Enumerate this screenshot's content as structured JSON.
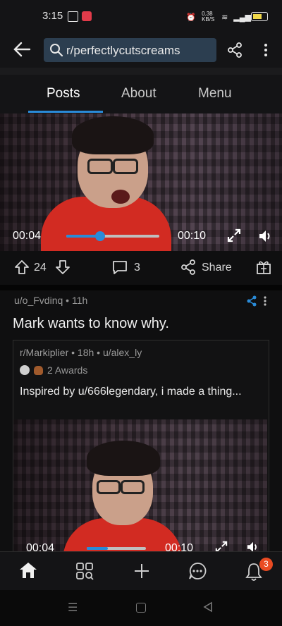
{
  "status": {
    "time": "3:15",
    "network": "0.38 KB/S"
  },
  "header": {
    "search_text": "r/perfectlycutscreams"
  },
  "tabs": [
    {
      "label": "Posts"
    },
    {
      "label": "About"
    },
    {
      "label": "Menu"
    }
  ],
  "video1": {
    "current": "00:04",
    "end": "00:10",
    "progress": 0.36
  },
  "actions": {
    "votes": "24",
    "comments": "3",
    "share": "Share"
  },
  "post": {
    "meta": "u/o_Fvdinq • 11h",
    "title": "Mark wants to know why.",
    "crosspost_meta": "r/Markiplier • 18h • u/alex_ly",
    "awards": "2 Awards",
    "text": "Inspired by u/666legendary, i made a thing..."
  },
  "video2": {
    "current": "00:04",
    "end": "00:10",
    "progress": 0.36
  },
  "bottom_nav": {
    "notification_count": "3"
  },
  "colors": {
    "accent": "#2a8bd8",
    "badge": "#ea4b22",
    "search_bg": "#2c3e50"
  }
}
